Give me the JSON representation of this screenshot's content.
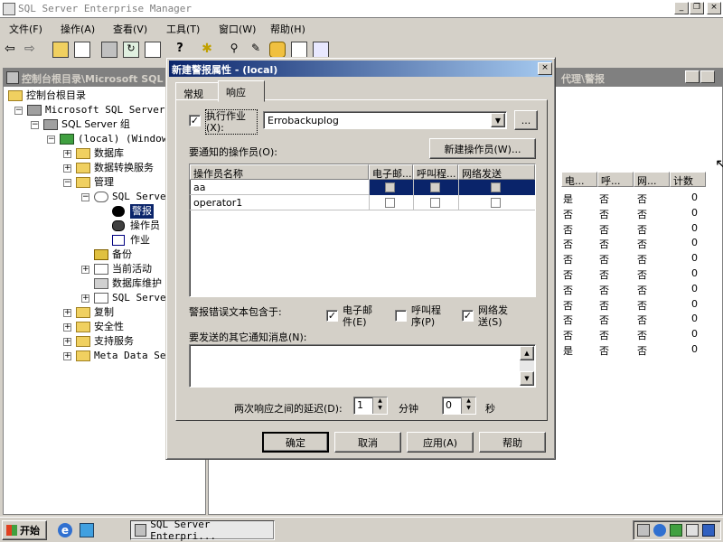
{
  "app": {
    "title": "SQL Server Enterprise Manager",
    "menu": [
      "文件(F)",
      "操作(A)",
      "查看(V)",
      "工具(T)",
      "窗口(W)",
      "帮助(H)"
    ]
  },
  "tree": {
    "title": "控制台根目录\\Microsoft SQL",
    "items": [
      {
        "label": "控制台根目录"
      },
      {
        "label": "Microsoft SQL Servers"
      },
      {
        "label": "SQL Server 组"
      },
      {
        "label": "(local) (Windows"
      },
      {
        "label": "数据库"
      },
      {
        "label": "数据转换服务"
      },
      {
        "label": "管理"
      },
      {
        "label": "SQL Server"
      },
      {
        "label": "警报"
      },
      {
        "label": "操作员"
      },
      {
        "label": "作业"
      },
      {
        "label": "备份"
      },
      {
        "label": "当前活动"
      },
      {
        "label": "数据库维护"
      },
      {
        "label": "SQL Server"
      },
      {
        "label": "复制"
      },
      {
        "label": "安全性"
      },
      {
        "label": "支持服务"
      },
      {
        "label": "Meta Data Ser"
      }
    ]
  },
  "list": {
    "title_suffix": "代理\\警报",
    "columns": [
      "电...",
      "呼...",
      "网...",
      "计数"
    ],
    "rows": [
      [
        "是",
        "否",
        "否",
        "0"
      ],
      [
        "否",
        "否",
        "否",
        "0"
      ],
      [
        "否",
        "否",
        "否",
        "0"
      ],
      [
        "否",
        "否",
        "否",
        "0"
      ],
      [
        "否",
        "否",
        "否",
        "0"
      ],
      [
        "否",
        "否",
        "否",
        "0"
      ],
      [
        "否",
        "否",
        "否",
        "0"
      ],
      [
        "否",
        "否",
        "否",
        "0"
      ],
      [
        "否",
        "否",
        "否",
        "0"
      ],
      [
        "否",
        "否",
        "否",
        "0"
      ],
      [
        "是",
        "否",
        "否",
        "0"
      ]
    ]
  },
  "dialog": {
    "title": "新建警报属性 - (local)",
    "tabs": [
      "常规",
      "响应"
    ],
    "execute_job_label": "执行作业(X):",
    "job_value": "Errobackuplog",
    "browse_label": "...",
    "operators_label": "要通知的操作员(O):",
    "new_operator_button": "新建操作员(W)...",
    "grid_columns": [
      "操作员名称",
      "电子邮...",
      "呼叫程...",
      "网络发送"
    ],
    "operators": [
      "aa",
      "operator1"
    ],
    "include_error_label": "警报错误文本包含于:",
    "email_label_1": "电子邮",
    "email_label_2": "件(E)",
    "pager_label_1": "呼叫程",
    "pager_label_2": "序(P)",
    "netsend_label_1": "网络发",
    "netsend_label_2": "送(S)",
    "additional_message_label": "要发送的其它通知消息(N):",
    "delay_label": "两次响应之间的延迟(D):",
    "minutes_value": "1",
    "minutes_label": "分钟",
    "seconds_value": "0",
    "seconds_label": "秒",
    "ok_button": "确定",
    "cancel_button": "取消",
    "apply_button": "应用(A)",
    "help_button": "帮助"
  },
  "taskbar": {
    "start_label": "开始",
    "task_label": "SQL Server Enterpri..."
  }
}
